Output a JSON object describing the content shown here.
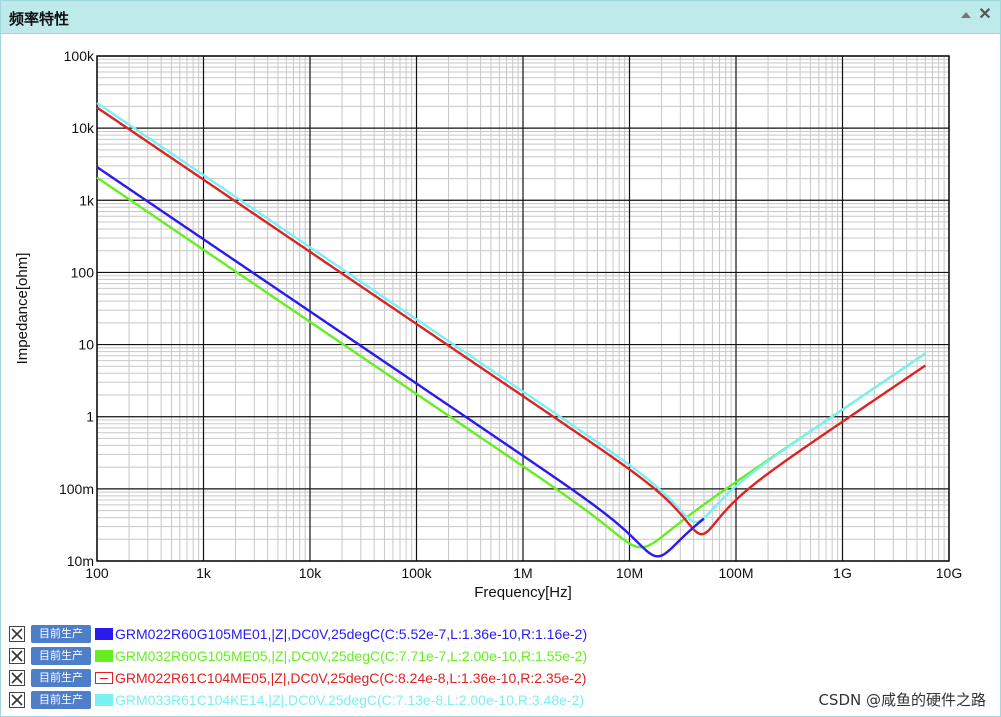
{
  "window": {
    "title": "频率特性",
    "collapse_icon": "triangle-up-icon",
    "close_label": "✕"
  },
  "chart_data": {
    "type": "line",
    "title": "",
    "xlabel": "Frequency[Hz]",
    "ylabel": "Impedance[ohm]",
    "xscale": "log",
    "yscale": "log",
    "xlim": [
      100,
      10000000000
    ],
    "ylim": [
      0.01,
      100000
    ],
    "grid": true,
    "x_ticks": [
      {
        "value": 100,
        "label": "100"
      },
      {
        "value": 1000,
        "label": "1k"
      },
      {
        "value": 10000,
        "label": "10k"
      },
      {
        "value": 100000,
        "label": "100k"
      },
      {
        "value": 1000000,
        "label": "1M"
      },
      {
        "value": 10000000,
        "label": "10M"
      },
      {
        "value": 100000000,
        "label": "100M"
      },
      {
        "value": 1000000000,
        "label": "1G"
      },
      {
        "value": 10000000000,
        "label": "10G"
      }
    ],
    "y_ticks": [
      {
        "value": 0.01,
        "label": "10m"
      },
      {
        "value": 0.1,
        "label": "100m"
      },
      {
        "value": 1,
        "label": "1"
      },
      {
        "value": 10,
        "label": "10"
      },
      {
        "value": 100,
        "label": "100"
      },
      {
        "value": 1000,
        "label": "1k"
      },
      {
        "value": 10000,
        "label": "10k"
      },
      {
        "value": 100000,
        "label": "100k"
      }
    ],
    "freq_range": [
      100,
      6000000000
    ],
    "series": [
      {
        "name": "GRM022R60G105ME01,|Z|,DC0V,25degC(C:5.52e-7,L:1.36e-10,R:1.16e-2)",
        "color": "#2a1aee",
        "C": 5.52e-07,
        "L": 1.36e-10,
        "R": 0.0116,
        "f_max": 50000000
      },
      {
        "name": "GRM032R60G105ME05,|Z|,DC0V,25degC(C:7.71e-7,L:2.00e-10,R:1.55e-2)",
        "color": "#66ee22",
        "C": 7.71e-07,
        "L": 2e-10,
        "R": 0.0155,
        "f_max": 6000000000
      },
      {
        "name": "GRM022R61C104ME05,|Z|,DC0V,25degC(C:8.24e-8,L:1.36e-10,R:2.35e-2)",
        "color": "#dd2222",
        "C": 8.24e-08,
        "L": 1.36e-10,
        "R": 0.0235,
        "f_max": 6000000000
      },
      {
        "name": "GRM033R61C104KE14,|Z|,DC0V,25degC(C:7.13e-8,L:2.00e-10,R:3.48e-2)",
        "color": "#7af0f4",
        "C": 7.13e-08,
        "L": 2e-10,
        "R": 0.0348,
        "f_max": 6000000000
      }
    ]
  },
  "legend": {
    "badge_label": "目前生产",
    "items": [
      {
        "label": "GRM022R60G105ME01,|Z|,DC0V,25degC(C:5.52e-7,L:1.36e-10,R:1.16e-2)",
        "color": "#2a1aee",
        "swatch": "solid"
      },
      {
        "label": "GRM032R60G105ME05,|Z|,DC0V,25degC(C:7.71e-7,L:2.00e-10,R:1.55e-2)",
        "color": "#66ee22",
        "swatch": "solid"
      },
      {
        "label": "GRM022R61C104ME05,|Z|,DC0V,25degC(C:8.24e-8,L:1.36e-10,R:2.35e-2)",
        "color": "#dd2222",
        "swatch": "line"
      },
      {
        "label": "GRM033R61C104KE14,|Z|,DC0V,25degC(C:7.13e-8,L:2.00e-10,R:3.48e-2)",
        "color": "#7af0f4",
        "swatch": "solid"
      }
    ]
  },
  "watermark": "CSDN @咸鱼的硬件之路"
}
